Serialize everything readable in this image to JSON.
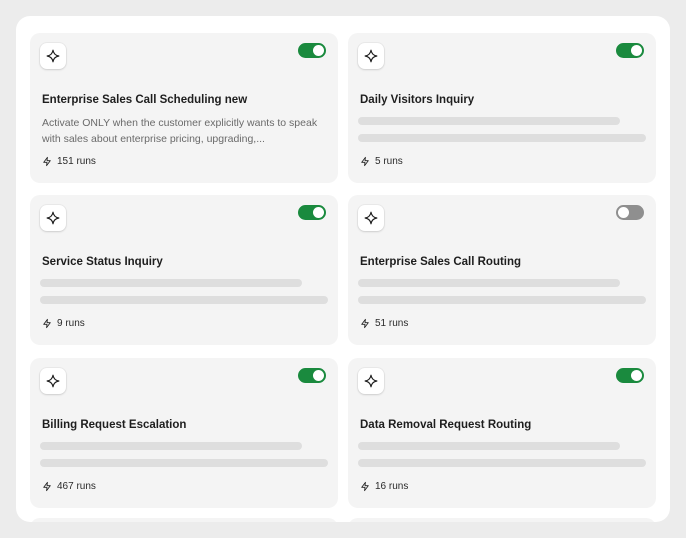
{
  "cards": [
    {
      "title": "Enterprise Sales Call Scheduling new",
      "description": "Activate ONLY when the customer explicitly wants to speak with sales about enterprise pricing, upgrading,...",
      "runs": "151 runs",
      "enabled": true
    },
    {
      "title": "Daily Visitors Inquiry",
      "description": "",
      "runs": "5 runs",
      "enabled": true
    },
    {
      "title": "Service Status Inquiry",
      "description": "",
      "runs": "9 runs",
      "enabled": true
    },
    {
      "title": "Enterprise Sales Call Routing",
      "description": "",
      "runs": "51 runs",
      "enabled": false
    },
    {
      "title": "Billing Request Escalation",
      "description": "",
      "runs": "467 runs",
      "enabled": true
    },
    {
      "title": "Data Removal Request Routing",
      "description": "",
      "runs": "16 runs",
      "enabled": true
    }
  ],
  "icons": {
    "card_icon": "sparkle-icon",
    "runs_icon": "lightning-bolt-icon"
  },
  "colors": {
    "toggle_on": "#1a8a3e",
    "toggle_off": "#8f8f8f",
    "card_background": "#f4f4f4",
    "page_background": "#ececec"
  }
}
